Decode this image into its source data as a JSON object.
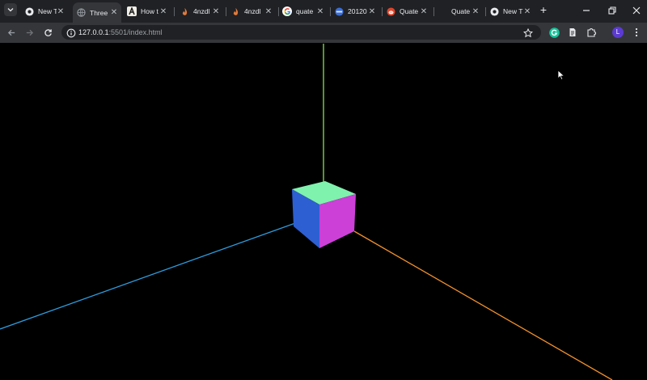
{
  "tabs": [
    {
      "title": "New T",
      "icon": "chrome-icon"
    },
    {
      "title": "Three",
      "icon": "globe-icon",
      "active": true
    },
    {
      "title": "How t",
      "icon": "anthropic-icon"
    },
    {
      "title": "4nzdl",
      "icon": "flame-icon"
    },
    {
      "title": "4nzdl",
      "icon": "flame-icon"
    },
    {
      "title": "quate",
      "icon": "google-icon"
    },
    {
      "title": "20120",
      "icon": "site-icon"
    },
    {
      "title": "Quate",
      "icon": "reddit-icon"
    },
    {
      "title": "Quate",
      "icon": ""
    },
    {
      "title": "New T",
      "icon": "chrome-icon"
    }
  ],
  "tab_close_glyph": "✕",
  "new_tab_glyph": "+",
  "url": {
    "host": "127.0.0.1",
    "path": ":5501/index.html"
  },
  "profile_initial": "L",
  "scene": {
    "background": "#000000",
    "axis_colors": {
      "x": "#f0902c",
      "y": "#86e34b",
      "z": "#2d9bdc"
    },
    "cube_face_colors": {
      "top": "#7ff2ad",
      "left": "#2d5fd2",
      "right": "#cc40d8"
    }
  }
}
